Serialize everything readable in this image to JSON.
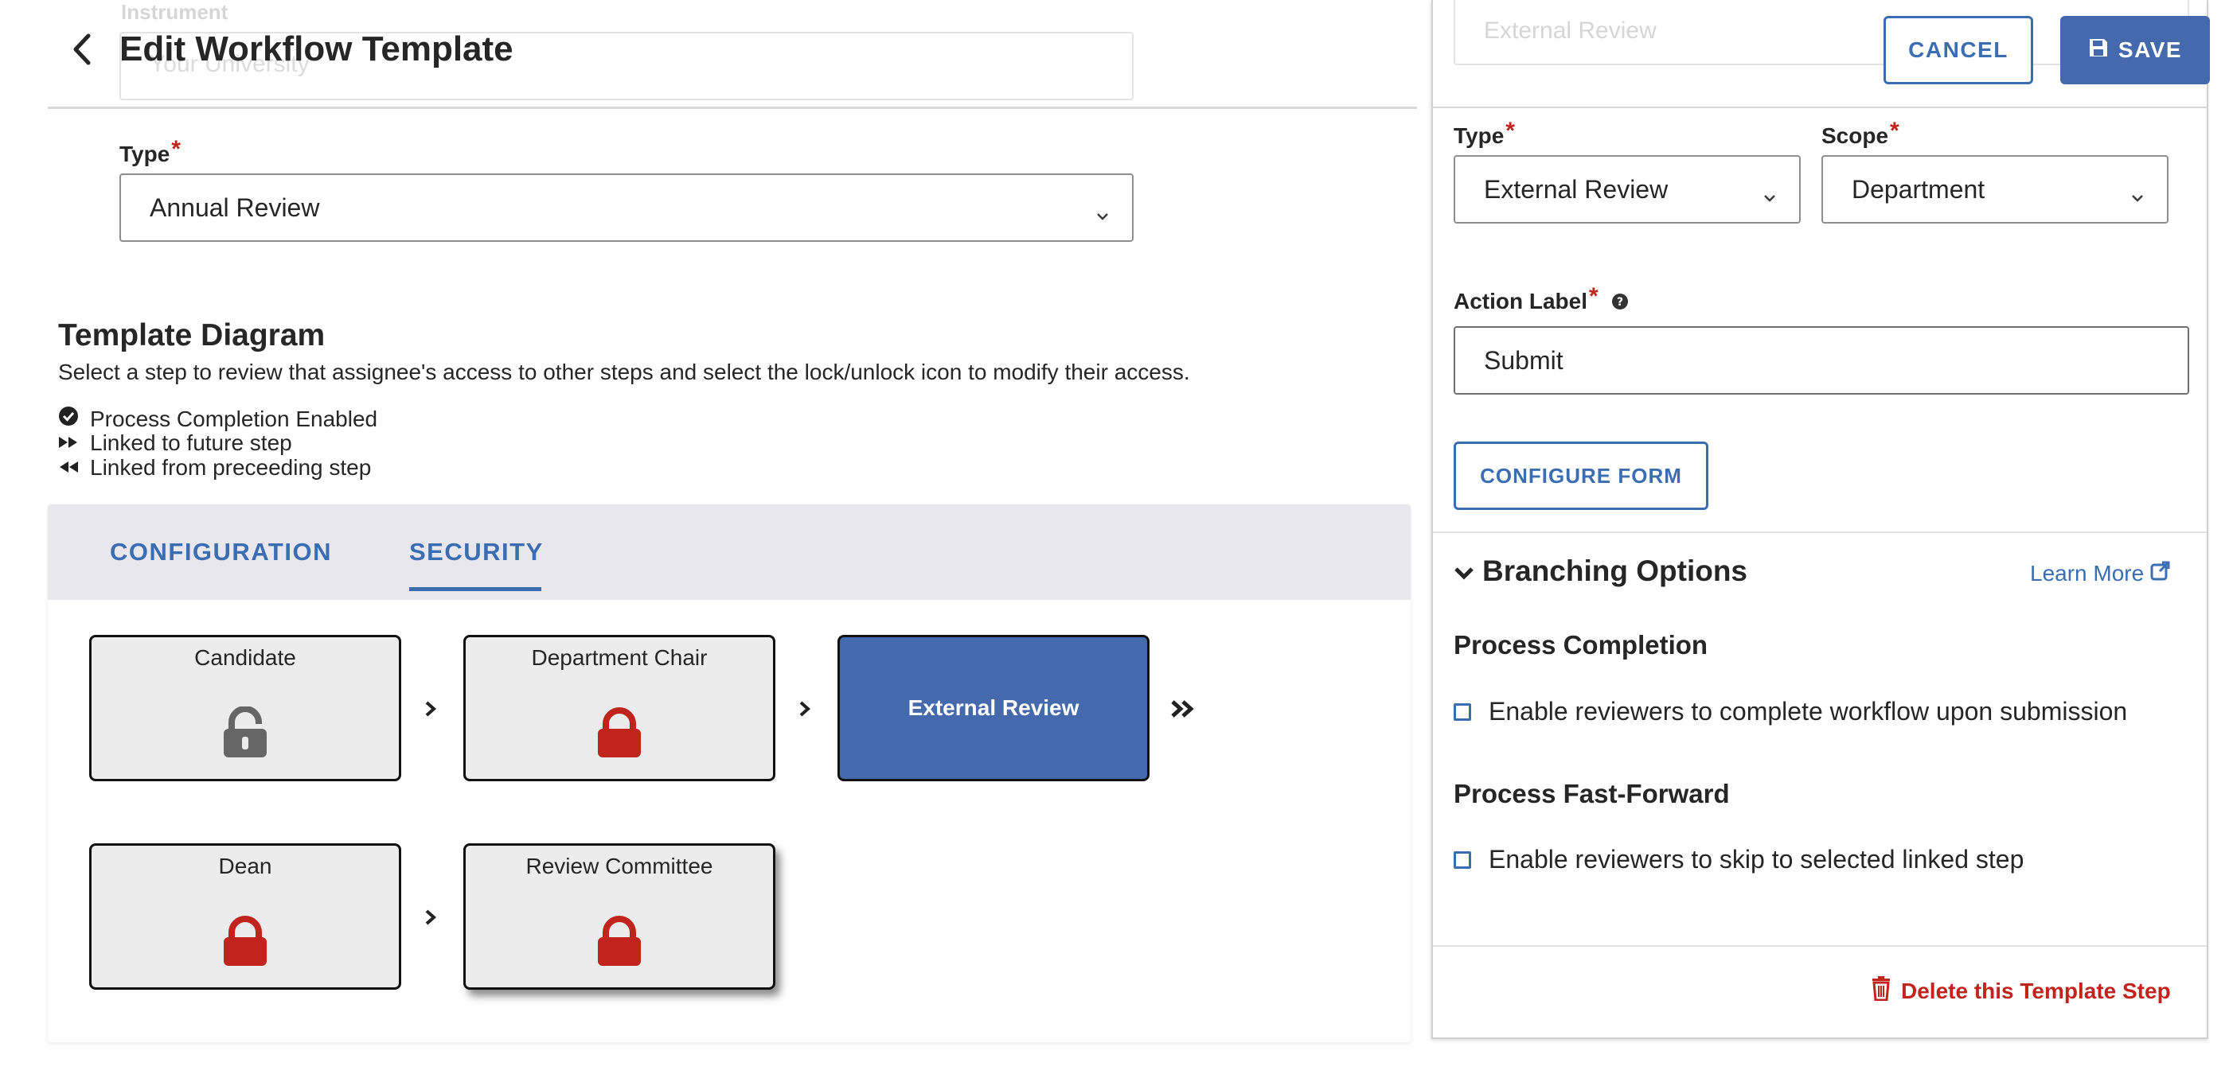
{
  "header": {
    "title": "Edit Workflow Template",
    "ghost_instrument_label": "Instrument",
    "ghost_instrument_value": "Your University"
  },
  "type_field": {
    "label": "Type",
    "required_mark": "*",
    "value": "Annual Review"
  },
  "diagram": {
    "title": "Template Diagram",
    "description": "Select a step to review that assignee's access to other steps and select the lock/unlock icon to modify their access.",
    "legend": {
      "completion": "Process Completion Enabled",
      "future": "Linked to future step",
      "preceding": "Linked from preceeding step"
    },
    "tabs": {
      "configuration": "CONFIGURATION",
      "security": "SECURITY"
    },
    "steps": [
      {
        "label": "Candidate",
        "lock": "unlocked"
      },
      {
        "label": "Department Chair",
        "lock": "locked"
      },
      {
        "label": "External Review",
        "lock": "none",
        "selected": true
      },
      {
        "label": "Dean",
        "lock": "locked"
      },
      {
        "label": "Review Committee",
        "lock": "locked"
      }
    ]
  },
  "drawer": {
    "ghost_name_value": "External Review",
    "cancel_label": "CANCEL",
    "save_label": "SAVE",
    "type_label": "Type",
    "type_value": "External Review",
    "scope_label": "Scope",
    "scope_value": "Department",
    "required_mark": "*",
    "action_label_label": "Action Label",
    "action_label_value": "Submit",
    "configure_form_label": "CONFIGURE FORM",
    "branching_title": "Branching Options",
    "learn_more": "Learn More",
    "process_completion_title": "Process Completion",
    "process_completion_option": "Enable reviewers to complete workflow upon submission",
    "process_fastforward_title": "Process Fast-Forward",
    "process_fastforward_option": "Enable reviewers to skip to selected linked step",
    "delete_label": "Delete this Template Step"
  },
  "colors": {
    "accent": "#3a6db1",
    "selected_step": "#4469ad",
    "lock_red": "#c0241c",
    "unlock_gray": "#666666",
    "tab_bar": "#e8e7ee"
  }
}
